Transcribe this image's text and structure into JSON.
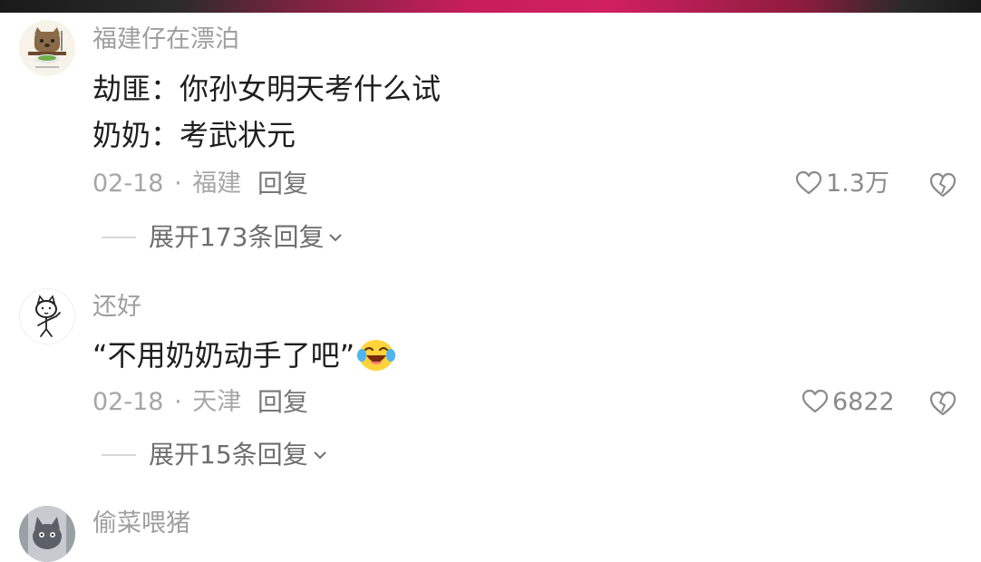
{
  "comments": [
    {
      "username": "福建仔在漂泊",
      "avatar_icon": "cat-avatar-icon",
      "lines": [
        "劫匪：你孙女明天考什么试",
        "奶奶：考武状元"
      ],
      "date": "02-18",
      "sep": "·",
      "location": "福建",
      "reply_label": "回复",
      "likes": "1.3万",
      "expand_label": "展开173条回复"
    },
    {
      "username": "还好",
      "avatar_icon": "doodle-avatar-icon",
      "lines": [
        "“不用奶奶动手了吧”"
      ],
      "emoji": "laughing-tears-emoji",
      "date": "02-18",
      "sep": "·",
      "location": "天津",
      "reply_label": "回复",
      "likes": "6822",
      "expand_label": "展开15条回复"
    },
    {
      "username": "偷菜喂猪",
      "avatar_icon": "cat-photo-avatar-icon"
    }
  ],
  "colors": {
    "username": "#9e9e9e",
    "text": "#1e1e1e",
    "meta": "#a6a6a6"
  }
}
